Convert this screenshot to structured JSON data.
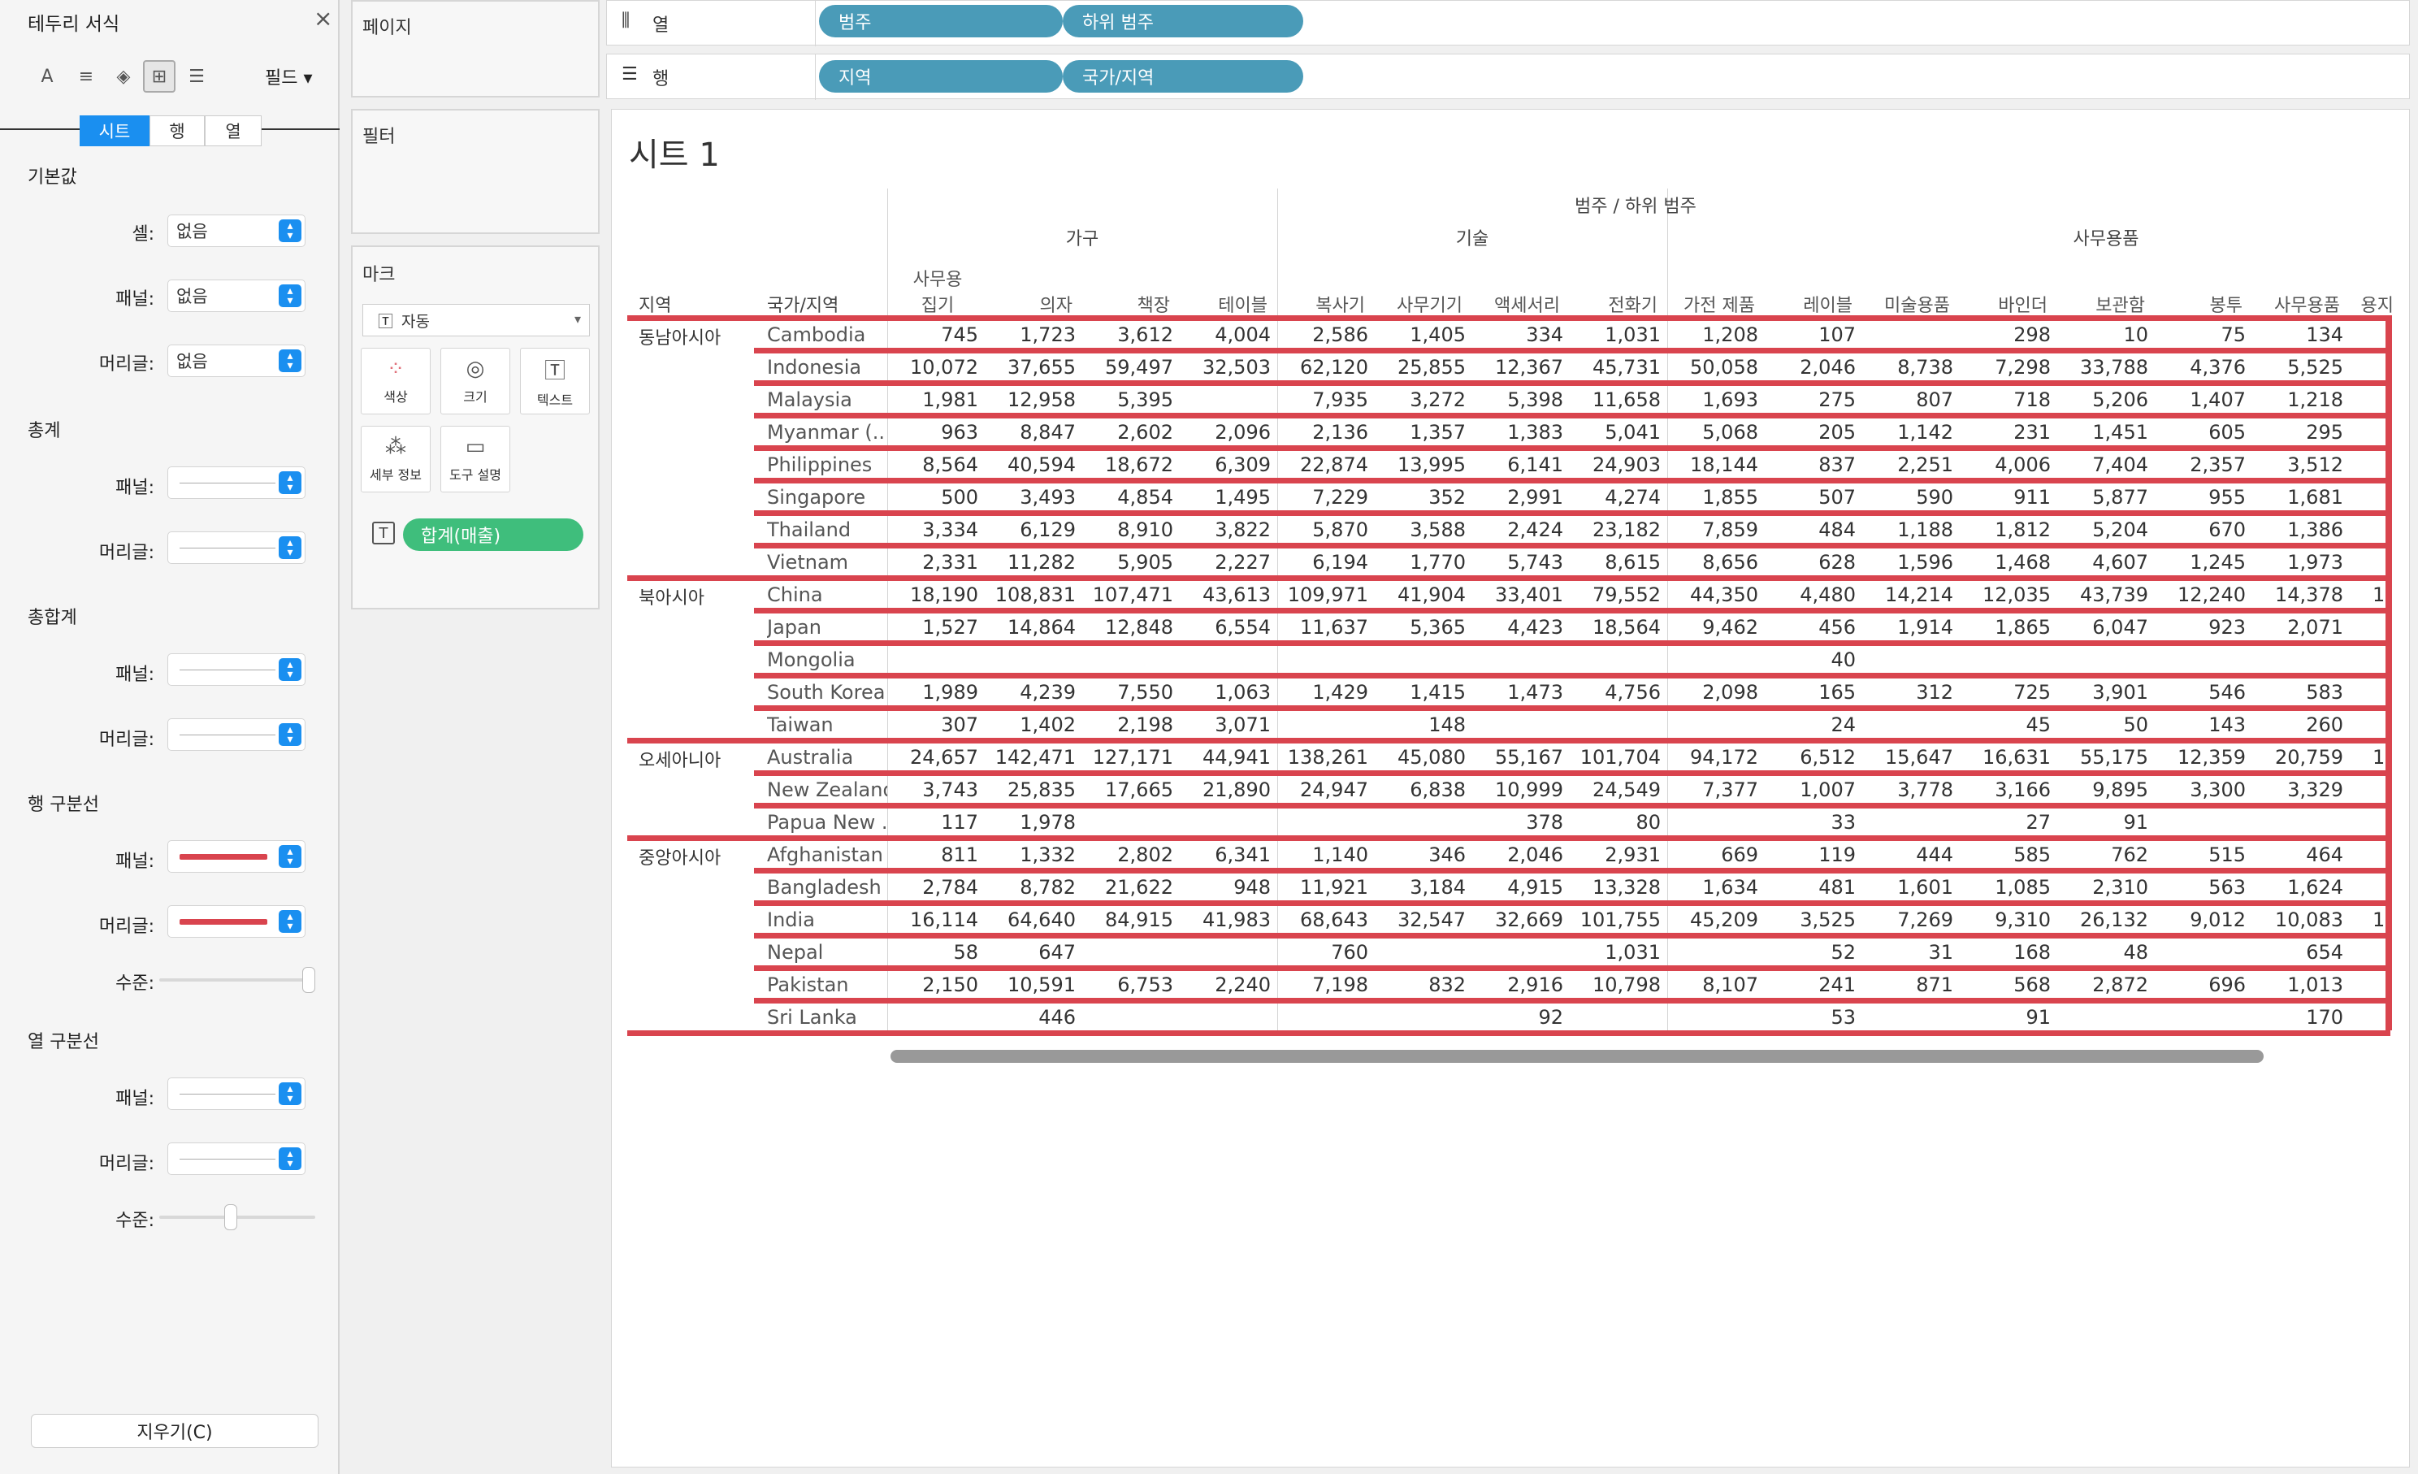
{
  "format_pane": {
    "title": "테두리 서식",
    "close": "×",
    "field_dropdown": "필드",
    "tabs": [
      "시트",
      "행",
      "열"
    ],
    "default_section": "기본값",
    "cell_label": "셀:",
    "pane_label": "패널:",
    "header_label": "머리글:",
    "level_label": "수준:",
    "none_value": "없음",
    "totals_section": "총계",
    "grand_totals_section": "총합계",
    "row_divider_section": "행 구분선",
    "col_divider_section": "열 구분선",
    "row_divider_level": 1.0,
    "col_divider_level": 0.5,
    "clear_button": "지우기(C)",
    "divider_color": "#d9444e",
    "accent_color": "#1a8ff0"
  },
  "cards": {
    "pages": "페이지",
    "filters": "필터",
    "marks": "마크",
    "mark_type": "자동",
    "mark_buttons": [
      "색상",
      "크기",
      "텍스트",
      "세부 정보",
      "도구 설명"
    ],
    "measure_pill": "합계(매출)"
  },
  "shelves": {
    "columns_label": "열",
    "rows_label": "행",
    "column_pills": [
      "범주",
      "하위 범주"
    ],
    "row_pills": [
      "지역",
      "국가/지역"
    ]
  },
  "sheet": {
    "title": "시트 1",
    "top_header": "범주 / 하위 범주",
    "categories": [
      "가구",
      "기술",
      "사무용품"
    ],
    "row_header_region": "지역",
    "row_header_country": "국가/지역",
    "subcategories": [
      "사무용\n집기",
      "의자",
      "책장",
      "테이블",
      "복사기",
      "사무기기",
      "액세서리",
      "전화기",
      "가전 제품",
      "레이블",
      "미술용품",
      "바인더",
      "보관함",
      "봉투",
      "사무용품",
      "용지"
    ],
    "regions": [
      {
        "name": "동남아시아",
        "countries": [
          {
            "name": "Cambodia",
            "values": [
              "745",
              "1,723",
              "3,612",
              "4,004",
              "2,586",
              "1,405",
              "334",
              "1,031",
              "1,208",
              "107",
              "",
              "298",
              "10",
              "75",
              "134",
              ""
            ]
          },
          {
            "name": "Indonesia",
            "values": [
              "10,072",
              "37,655",
              "59,497",
              "32,503",
              "62,120",
              "25,855",
              "12,367",
              "45,731",
              "50,058",
              "2,046",
              "8,738",
              "7,298",
              "33,788",
              "4,376",
              "5,525",
              ""
            ]
          },
          {
            "name": "Malaysia",
            "values": [
              "1,981",
              "12,958",
              "5,395",
              "",
              "7,935",
              "3,272",
              "5,398",
              "11,658",
              "1,693",
              "275",
              "807",
              "718",
              "5,206",
              "1,407",
              "1,218",
              ""
            ]
          },
          {
            "name": "Myanmar (..",
            "values": [
              "963",
              "8,847",
              "2,602",
              "2,096",
              "2,136",
              "1,357",
              "1,383",
              "5,041",
              "5,068",
              "205",
              "1,142",
              "231",
              "1,451",
              "605",
              "295",
              ""
            ]
          },
          {
            "name": "Philippines",
            "values": [
              "8,564",
              "40,594",
              "18,672",
              "6,309",
              "22,874",
              "13,995",
              "6,141",
              "24,903",
              "18,144",
              "837",
              "2,251",
              "4,006",
              "7,404",
              "2,357",
              "3,512",
              ""
            ]
          },
          {
            "name": "Singapore",
            "values": [
              "500",
              "3,493",
              "4,854",
              "1,495",
              "7,229",
              "352",
              "2,991",
              "4,274",
              "1,855",
              "507",
              "590",
              "911",
              "5,877",
              "955",
              "1,681",
              ""
            ]
          },
          {
            "name": "Thailand",
            "values": [
              "3,334",
              "6,129",
              "8,910",
              "3,822",
              "5,870",
              "3,588",
              "2,424",
              "23,182",
              "7,859",
              "484",
              "1,188",
              "1,812",
              "5,204",
              "670",
              "1,386",
              ""
            ]
          },
          {
            "name": "Vietnam",
            "values": [
              "2,331",
              "11,282",
              "5,905",
              "2,227",
              "6,194",
              "1,770",
              "5,743",
              "8,615",
              "8,656",
              "628",
              "1,596",
              "1,468",
              "4,607",
              "1,245",
              "1,973",
              ""
            ]
          }
        ]
      },
      {
        "name": "북아시아",
        "countries": [
          {
            "name": "China",
            "values": [
              "18,190",
              "108,831",
              "107,471",
              "43,613",
              "109,971",
              "41,904",
              "33,401",
              "79,552",
              "44,350",
              "4,480",
              "14,214",
              "12,035",
              "43,739",
              "12,240",
              "14,378",
              "1"
            ]
          },
          {
            "name": "Japan",
            "values": [
              "1,527",
              "14,864",
              "12,848",
              "6,554",
              "11,637",
              "5,365",
              "4,423",
              "18,564",
              "9,462",
              "456",
              "1,914",
              "1,865",
              "6,047",
              "923",
              "2,071",
              ""
            ]
          },
          {
            "name": "Mongolia",
            "values": [
              "",
              "",
              "",
              "",
              "",
              "",
              "",
              "",
              "",
              "40",
              "",
              "",
              "",
              "",
              "",
              ""
            ]
          },
          {
            "name": "South Korea",
            "values": [
              "1,989",
              "4,239",
              "7,550",
              "1,063",
              "1,429",
              "1,415",
              "1,473",
              "4,756",
              "2,098",
              "165",
              "312",
              "725",
              "3,901",
              "546",
              "583",
              ""
            ]
          },
          {
            "name": "Taiwan",
            "values": [
              "307",
              "1,402",
              "2,198",
              "3,071",
              "",
              "148",
              "",
              "",
              "",
              "24",
              "",
              "45",
              "50",
              "143",
              "260",
              ""
            ]
          }
        ]
      },
      {
        "name": "오세아니아",
        "countries": [
          {
            "name": "Australia",
            "values": [
              "24,657",
              "142,471",
              "127,171",
              "44,941",
              "138,261",
              "45,080",
              "55,167",
              "101,704",
              "94,172",
              "6,512",
              "15,647",
              "16,631",
              "55,175",
              "12,359",
              "20,759",
              "1"
            ]
          },
          {
            "name": "New Zealand",
            "values": [
              "3,743",
              "25,835",
              "17,665",
              "21,890",
              "24,947",
              "6,838",
              "10,999",
              "24,549",
              "7,377",
              "1,007",
              "3,778",
              "3,166",
              "9,895",
              "3,300",
              "3,329",
              ""
            ]
          },
          {
            "name": "Papua New ..",
            "values": [
              "117",
              "1,978",
              "",
              "",
              "",
              "",
              "378",
              "80",
              "",
              "33",
              "",
              "27",
              "91",
              "",
              "",
              ""
            ]
          }
        ]
      },
      {
        "name": "중앙아시아",
        "countries": [
          {
            "name": "Afghanistan",
            "values": [
              "811",
              "1,332",
              "2,802",
              "6,341",
              "1,140",
              "346",
              "2,046",
              "2,931",
              "669",
              "119",
              "444",
              "585",
              "762",
              "515",
              "464",
              ""
            ]
          },
          {
            "name": "Bangladesh",
            "values": [
              "2,784",
              "8,782",
              "21,622",
              "948",
              "11,921",
              "3,184",
              "4,915",
              "13,328",
              "1,634",
              "481",
              "1,601",
              "1,085",
              "2,310",
              "563",
              "1,624",
              ""
            ]
          },
          {
            "name": "India",
            "values": [
              "16,114",
              "64,640",
              "84,915",
              "41,983",
              "68,643",
              "32,547",
              "32,669",
              "101,755",
              "45,209",
              "3,525",
              "7,269",
              "9,310",
              "26,132",
              "9,012",
              "10,083",
              "1"
            ]
          },
          {
            "name": "Nepal",
            "values": [
              "58",
              "647",
              "",
              "",
              "760",
              "",
              "",
              "1,031",
              "",
              "52",
              "31",
              "168",
              "48",
              "",
              "654",
              ""
            ]
          },
          {
            "name": "Pakistan",
            "values": [
              "2,150",
              "10,591",
              "6,753",
              "2,240",
              "7,198",
              "832",
              "2,916",
              "10,798",
              "8,107",
              "241",
              "871",
              "568",
              "2,872",
              "696",
              "1,013",
              ""
            ]
          },
          {
            "name": "Sri Lanka",
            "values": [
              "",
              "446",
              "",
              "",
              "",
              "",
              "92",
              "",
              "",
              "53",
              "",
              "91",
              "",
              "",
              "170",
              ""
            ]
          }
        ]
      }
    ]
  }
}
